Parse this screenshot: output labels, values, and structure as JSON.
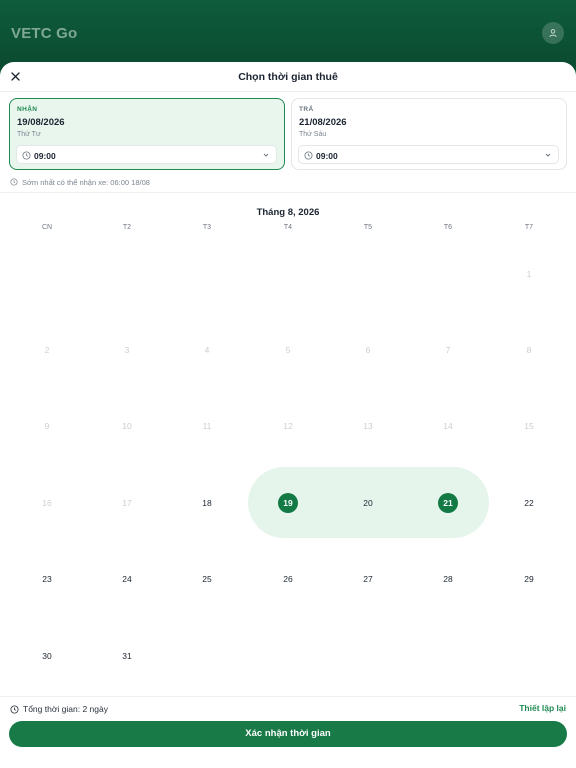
{
  "app": {
    "brand": "VETC Go"
  },
  "sheet": {
    "title": "Chọn thời gian thuê"
  },
  "pickup": {
    "label": "NHẬN",
    "date": "19/08/2026",
    "weekday": "Thứ Tư",
    "time": "09:00"
  },
  "return": {
    "label": "TRẢ",
    "date": "21/08/2026",
    "weekday": "Thứ Sáu",
    "time": "09:00"
  },
  "hint": "Sớm nhất có thể nhận xe: 06:00 18/08",
  "calendar": {
    "month_title": "Tháng 8, 2026",
    "weekdays": [
      "CN",
      "T2",
      "T3",
      "T4",
      "T5",
      "T6",
      "T7"
    ],
    "selected_start": "19",
    "selected_end": "21",
    "weeks": [
      [
        "",
        "",
        "",
        "",
        "",
        "",
        "1"
      ],
      [
        "2",
        "3",
        "4",
        "5",
        "6",
        "7",
        "8"
      ],
      [
        "9",
        "10",
        "11",
        "12",
        "13",
        "14",
        "15"
      ],
      [
        "16",
        "17",
        "18",
        "19",
        "20",
        "21",
        "22"
      ],
      [
        "23",
        "24",
        "25",
        "26",
        "27",
        "28",
        "29"
      ],
      [
        "30",
        "31",
        "",
        "",
        "",
        "",
        ""
      ]
    ],
    "disabled_days": [
      "1",
      "2",
      "3",
      "4",
      "5",
      "6",
      "7",
      "8",
      "9",
      "10",
      "11",
      "12",
      "13",
      "14",
      "15",
      "16",
      "17"
    ]
  },
  "footer": {
    "total": "Tổng thời gian: 2 ngày",
    "reset_label": "Thiết lập lại",
    "confirm_label": "Xác nhận thời gian"
  },
  "colors": {
    "primary": "#187a47",
    "range": "#e6f5ec",
    "header": "#0d5a3a"
  },
  "icons": [
    "user-icon",
    "close-icon",
    "clock-icon",
    "chevron-down-icon"
  ]
}
